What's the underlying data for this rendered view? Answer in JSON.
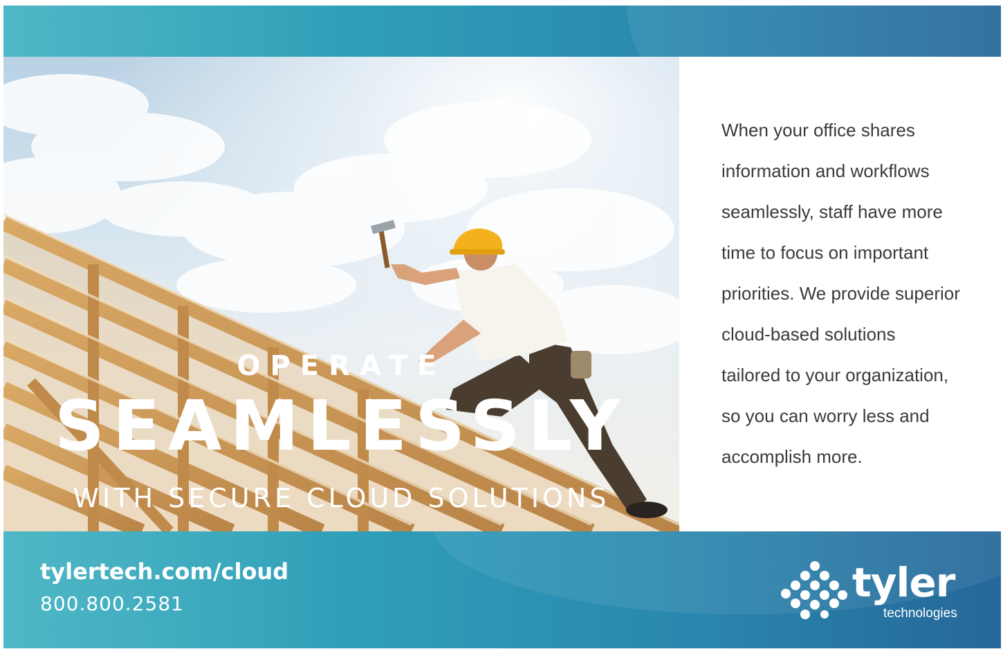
{
  "colors": {
    "band_start": "#4fb8c6",
    "band_end": "#25679a",
    "body_text": "#3a3a3a",
    "headline_text": "#ffffff"
  },
  "headline": {
    "kicker": "OPERATE",
    "main": "SEAMLESSLY",
    "sub": "WITH SECURE CLOUD SOLUTIONS"
  },
  "copy": {
    "lines": [
      "When your office shares",
      "information and workflows",
      "seamlessly, staff have more",
      "time to focus on important",
      "priorities. We provide superior",
      "cloud-based solutions",
      "tailored to your organization,",
      "so you can worry less and",
      "accomplish more."
    ]
  },
  "contact": {
    "url": "tylertech.com/cloud",
    "phone": "800.800.2581"
  },
  "logo": {
    "word": "tyler",
    "sub": "technologies",
    "mark_icon": "dot-cluster-icon"
  },
  "photo": {
    "subject_icon": "roofer-with-hammer-illustration"
  }
}
